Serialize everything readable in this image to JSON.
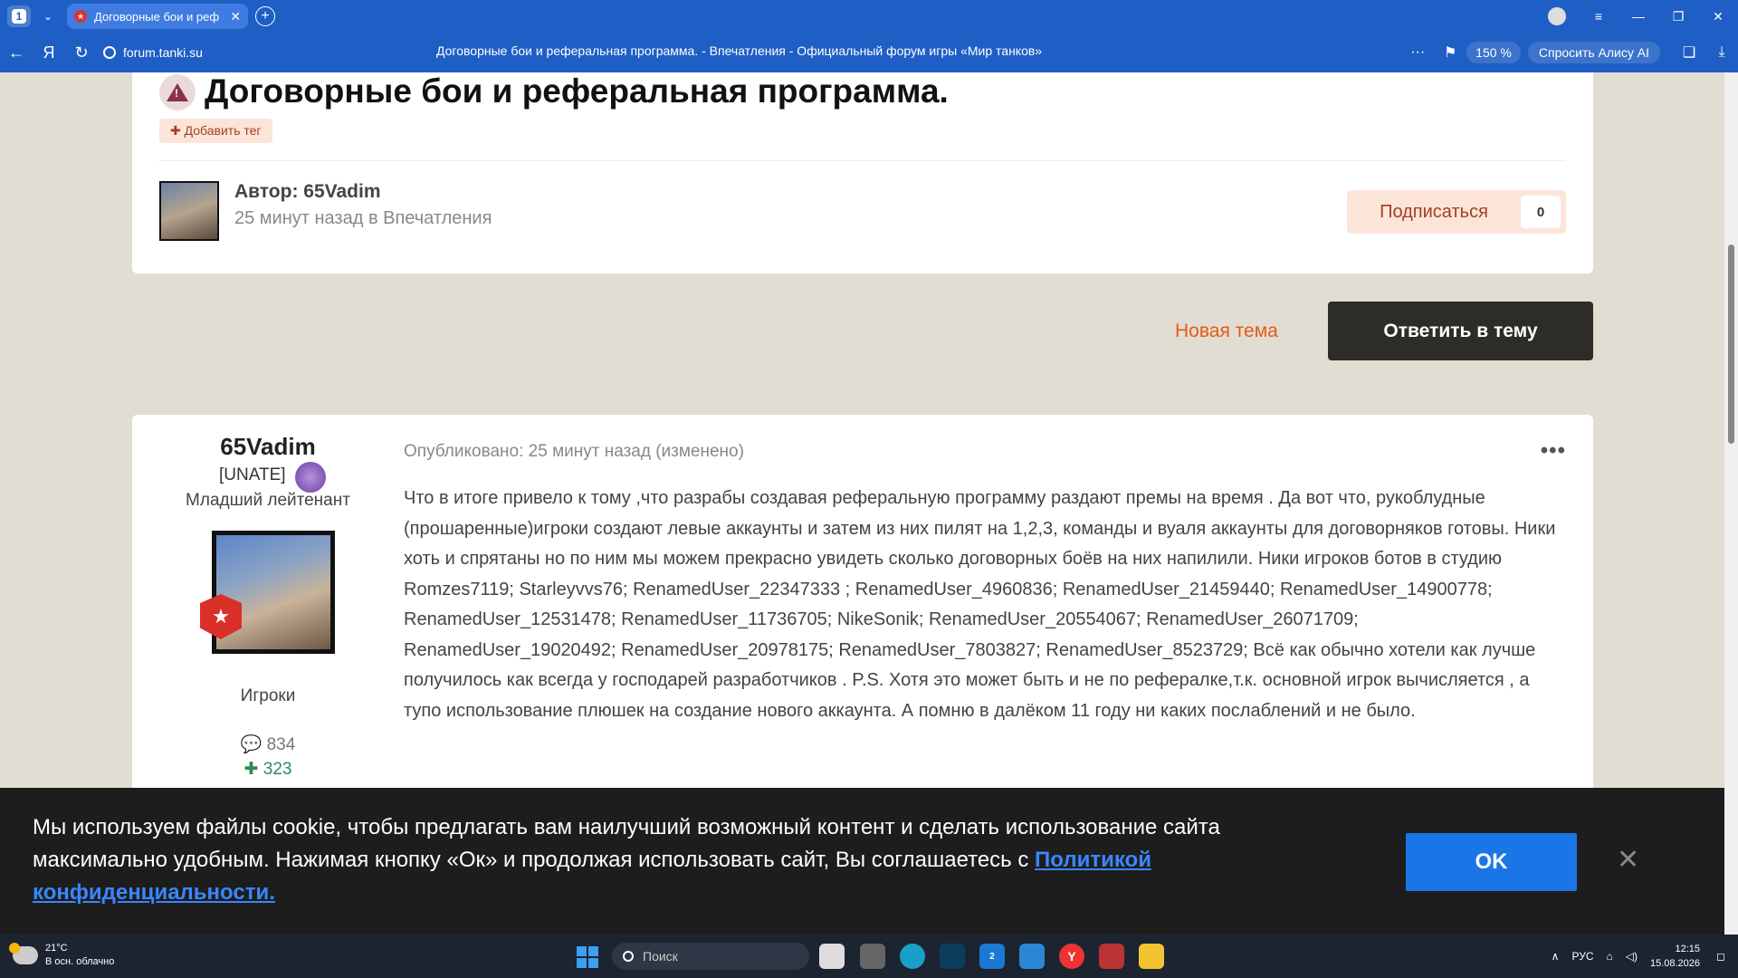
{
  "browser": {
    "tab_count": "1",
    "tab_title": "Договорные бои и реф",
    "url": "forum.tanki.su",
    "page_title": "Договорные бои и реферальная программа. - Впечатления - Официальный форум игры «Мир танков»",
    "zoom": "150 %",
    "alice": "Спросить Алису AI",
    "more": "···"
  },
  "topic": {
    "title": "Договорные бои и реферальная программа.",
    "add_tag": "✚ Добавить тег",
    "author": "Автор: 65Vadim",
    "meta": "25 минут назад в Впечатления",
    "subscribe_label": "Подписаться",
    "subscribe_count": "0"
  },
  "actions": {
    "new_topic": "Новая тема",
    "reply": "Ответить в тему"
  },
  "post": {
    "poster_name": "65Vadim",
    "clan": "[UNATE]",
    "rank": "Младший лейтенант",
    "group": "Игроки",
    "posts": "💬 834",
    "reputation": "✚ 323",
    "date": "Опубликовано: 25 минут назад (изменено)",
    "menu": "•••",
    "body": "Что в итоге привело к тому ,что разрабы создавая реферальную программу   раздают премы на время . Да вот что, рукоблудные (прошаренные)игроки  создают левые аккаунты и затем из них пилят на 1,2,3, команды и вуаля аккаунты для договорняков готовы. Ники хоть и спрятаны но по ним мы можем прекрасно увидеть сколько договорных боёв на них напилили. Ники игроков ботов в студию Romzes7119; Starleyvvs76; RenamedUser_22347333 ; RenamedUser_4960836; RenamedUser_21459440; RenamedUser_14900778; RenamedUser_12531478; RenamedUser_11736705; NikeSonik; RenamedUser_20554067; RenamedUser_26071709; RenamedUser_19020492; RenamedUser_20978175; RenamedUser_7803827; RenamedUser_8523729;  Всё как обычно хотели как лучше получилось как всегда у господарей разработчиков . P.S. Хотя это может быть и не по рефералке,т.к. основной игрок вычисляется , а тупо использование плюшек на создание нового аккаунта. А помню  в далёком 11 году ни каких послаблений и не было."
  },
  "cookie": {
    "text": "Мы используем файлы cookie, чтобы предлагать вам наилучший возможный контент и сделать использование сайта максимально удобным. Нажимая кнопку «Ок» и продолжая использовать сайт, Вы соглашаетесь с ",
    "link": "Политикой конфиденциальности.",
    "ok": "OK",
    "close": "✕"
  },
  "taskbar": {
    "temp": "21°C",
    "weather": "В осн. облачно",
    "search_placeholder": "Поиск",
    "lang": "РУС",
    "time": "12:15",
    "date": "15.08.2026",
    "badge": "2"
  },
  "colors": {
    "browser_blue": "#1f5fc5",
    "accent_orange": "#e45a14",
    "dark_button": "#2e2c27",
    "ok_blue": "#1a76e6"
  }
}
